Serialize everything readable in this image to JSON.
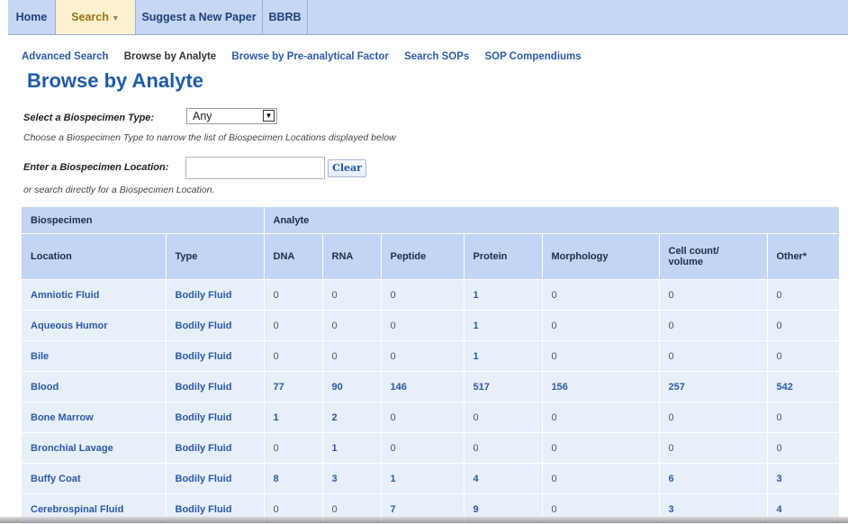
{
  "nav": {
    "tabs": [
      {
        "label": "Home"
      },
      {
        "label": "Search",
        "caret": "▼"
      },
      {
        "label": "Suggest a New Paper"
      },
      {
        "label": "BBRB"
      }
    ]
  },
  "subnav": {
    "items": [
      {
        "label": "Advanced Search"
      },
      {
        "label": "Browse by Analyte"
      },
      {
        "label": "Browse by Pre-analytical Factor"
      },
      {
        "label": "Search SOPs"
      },
      {
        "label": "SOP Compendiums"
      }
    ]
  },
  "page": {
    "title": "Browse by Analyte"
  },
  "filters": {
    "type_label": "Select a Biospecimen Type:",
    "type_value": "Any",
    "type_hint": "Choose a Biospecimen Type to narrow the list of Biospecimen Locations displayed below",
    "location_label": "Enter a Biospecimen Location:",
    "location_value": "",
    "clear_label": "Clear",
    "location_hint": "or search directly for a Biospecimen Location."
  },
  "table": {
    "group_headers": [
      "Biospecimen",
      "Analyte"
    ],
    "columns": [
      "Location",
      "Type",
      "DNA",
      "RNA",
      "Peptide",
      "Protein",
      "Morphology",
      "Cell count/ volume",
      "Other*"
    ],
    "rows": [
      [
        "Amniotic Fluid",
        "Bodily Fluid",
        "0",
        "0",
        "0",
        "1",
        "0",
        "0",
        "0"
      ],
      [
        "Aqueous Humor",
        "Bodily Fluid",
        "0",
        "0",
        "0",
        "1",
        "0",
        "0",
        "0"
      ],
      [
        "Bile",
        "Bodily Fluid",
        "0",
        "0",
        "0",
        "1",
        "0",
        "0",
        "0"
      ],
      [
        "Blood",
        "Bodily Fluid",
        "77",
        "90",
        "146",
        "517",
        "156",
        "257",
        "542"
      ],
      [
        "Bone Marrow",
        "Bodily Fluid",
        "1",
        "2",
        "0",
        "0",
        "0",
        "0",
        "0"
      ],
      [
        "Bronchial Lavage",
        "Bodily Fluid",
        "0",
        "1",
        "0",
        "0",
        "0",
        "0",
        "0"
      ],
      [
        "Buffy Coat",
        "Bodily Fluid",
        "8",
        "3",
        "1",
        "4",
        "0",
        "6",
        "3"
      ],
      [
        "Cerebrospinal Fluid",
        "Bodily Fluid",
        "0",
        "0",
        "7",
        "9",
        "0",
        "3",
        "4"
      ]
    ]
  },
  "colors": {
    "nav_bg": "#c6d7f3",
    "active_tab_bg": "#fbf1cf",
    "link": "#2a5aa6",
    "title": "#1e5aa8",
    "header_bg": "#c2d5f5",
    "row_bg": "#e7eff9"
  }
}
